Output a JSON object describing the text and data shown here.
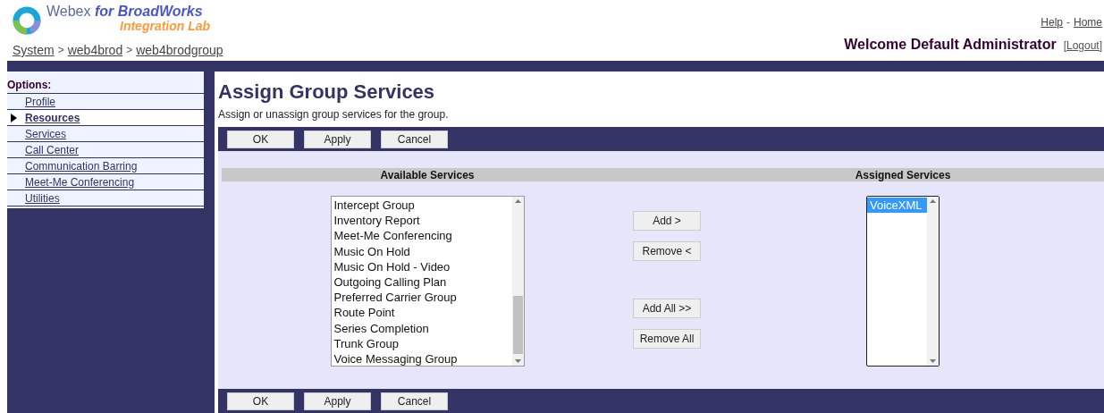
{
  "header": {
    "brand": "Webex",
    "brand_product": "for BroadWorks",
    "brand_sub": "Integration Lab",
    "links": [
      "Help",
      "Home"
    ],
    "links_separator": "-",
    "breadcrumb": [
      "System",
      "web4brod",
      "web4brodgroup"
    ],
    "breadcrumb_separator": ">",
    "welcome": "Welcome Default Administrator",
    "logout": "[Logout]"
  },
  "sidebar": {
    "heading": "Options:",
    "items": [
      {
        "label": "Profile",
        "selected": false
      },
      {
        "label": "Resources",
        "selected": true
      },
      {
        "label": "Services",
        "selected": false
      },
      {
        "label": "Call Center",
        "selected": false
      },
      {
        "label": "Communication Barring",
        "selected": false
      },
      {
        "label": "Meet-Me Conferencing",
        "selected": false
      },
      {
        "label": "Utilities",
        "selected": false
      }
    ]
  },
  "page": {
    "title": "Assign Group Services",
    "description": "Assign or unassign group services for the group.",
    "top_buttons": [
      "OK",
      "Apply",
      "Cancel"
    ],
    "available": {
      "heading": "Available Services",
      "items": [
        {
          "label": "Intercept Group",
          "selected": false
        },
        {
          "label": "Inventory Report",
          "selected": false
        },
        {
          "label": "Meet-Me Conferencing",
          "selected": false
        },
        {
          "label": "Music On Hold",
          "selected": false
        },
        {
          "label": "Music On Hold - Video",
          "selected": false
        },
        {
          "label": "Outgoing Calling Plan",
          "selected": false
        },
        {
          "label": "Preferred Carrier Group",
          "selected": false
        },
        {
          "label": "Route Point",
          "selected": false
        },
        {
          "label": "Series Completion",
          "selected": false
        },
        {
          "label": "Trunk Group",
          "selected": false
        },
        {
          "label": "Voice Messaging Group",
          "selected": false
        }
      ]
    },
    "move_buttons": [
      [
        "Add >",
        "Remove <"
      ],
      [
        "Add All >>",
        "Remove All"
      ]
    ],
    "assigned": {
      "heading": "Assigned Services",
      "items": [
        {
          "label": "VoiceXML",
          "selected": true
        }
      ]
    },
    "bottom_buttons": [
      "OK",
      "Apply",
      "Cancel"
    ]
  }
}
